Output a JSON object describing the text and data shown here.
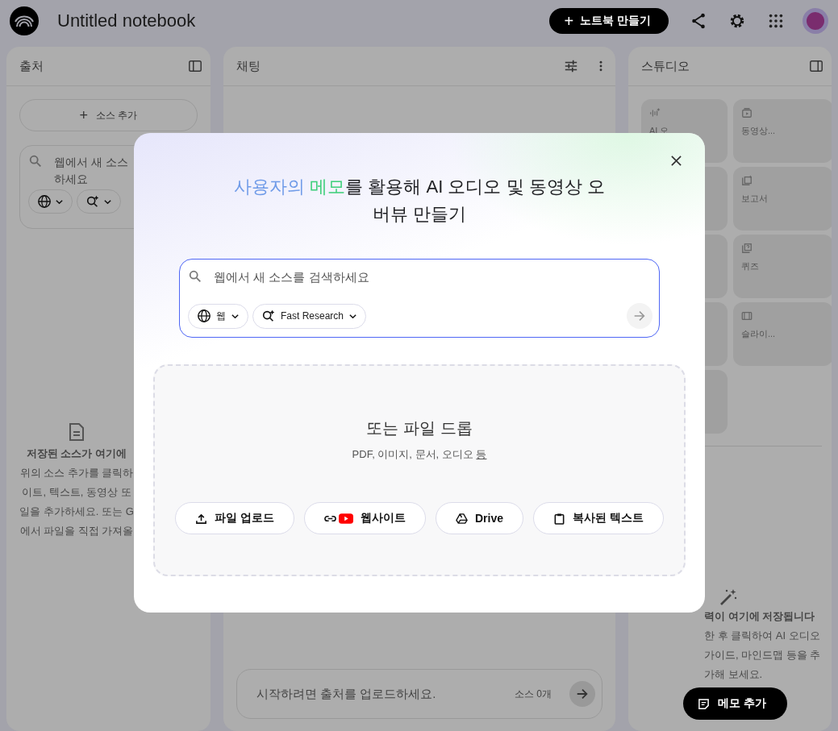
{
  "header": {
    "title": "Untitled notebook",
    "create_button": {
      "icon": "+",
      "label": "노트북 만들기"
    }
  },
  "sources_panel": {
    "title": "출처",
    "add_button": {
      "icon": "+",
      "label": "소스 추가"
    },
    "search": {
      "placeholder_lines": [
        "웹에서 새 소스",
        "하세요"
      ]
    },
    "empty_lines": [
      "저장된 소스가 여기에",
      "위의 소스 추가를 클릭하",
      "이트, 텍스트, 동영상 또",
      "일을 추가하세요. 또는 G",
      "에서 파일을 직접 가져올"
    ]
  },
  "chat_panel": {
    "title": "채팅",
    "input_placeholder": "시작하려면 출처를 업로드하세요.",
    "source_count": "소스 0개"
  },
  "studio_panel": {
    "title": "스튜디오",
    "tiles": [
      {
        "kind": "audio",
        "label": "AI 오"
      },
      {
        "kind": "video",
        "label": "동영상..."
      },
      {
        "kind": "blank"
      },
      {
        "kind": "report",
        "label": "보고서"
      },
      {
        "kind": "blank"
      },
      {
        "kind": "quiz",
        "label": "퀴즈"
      },
      {
        "kind": "blank"
      },
      {
        "kind": "slides",
        "label": "슬라이..."
      },
      {
        "kind": "blank"
      }
    ],
    "empty_lines": [
      "력이 여기에 저장됩니다",
      "한 후 클릭하여 AI 오디오",
      "가이드, 마인드맵 등을 추",
      "가해 보세요."
    ],
    "add_note_button": "메모 추가"
  },
  "dialog": {
    "title_parts": [
      {
        "text": "사용자의 ",
        "color": "#6f9be8"
      },
      {
        "text": "메모",
        "color": "#3ecf7a"
      },
      {
        "text": "를 활용해 AI 오디오 및 동영상 오버뷰 만들기",
        "color": "#202124"
      }
    ],
    "search": {
      "placeholder": "웹에서 새 소스를 검색하세요",
      "chips": [
        {
          "kind": "web",
          "label": "웹"
        },
        {
          "kind": "research",
          "label": "Fast Research"
        }
      ],
      "submit_disabled": true
    },
    "drop_title": "또는 파일 드롭",
    "drop_hint": "PDF, 이미지, 문서, 오디오",
    "drop_hint_link": "등",
    "buttons": [
      {
        "kind": "upload",
        "label": "파일 업로드"
      },
      {
        "kind": "website",
        "label": "웹사이트"
      },
      {
        "kind": "drive",
        "label": "Drive"
      },
      {
        "kind": "paste",
        "label": "복사된 텍스트"
      }
    ]
  }
}
